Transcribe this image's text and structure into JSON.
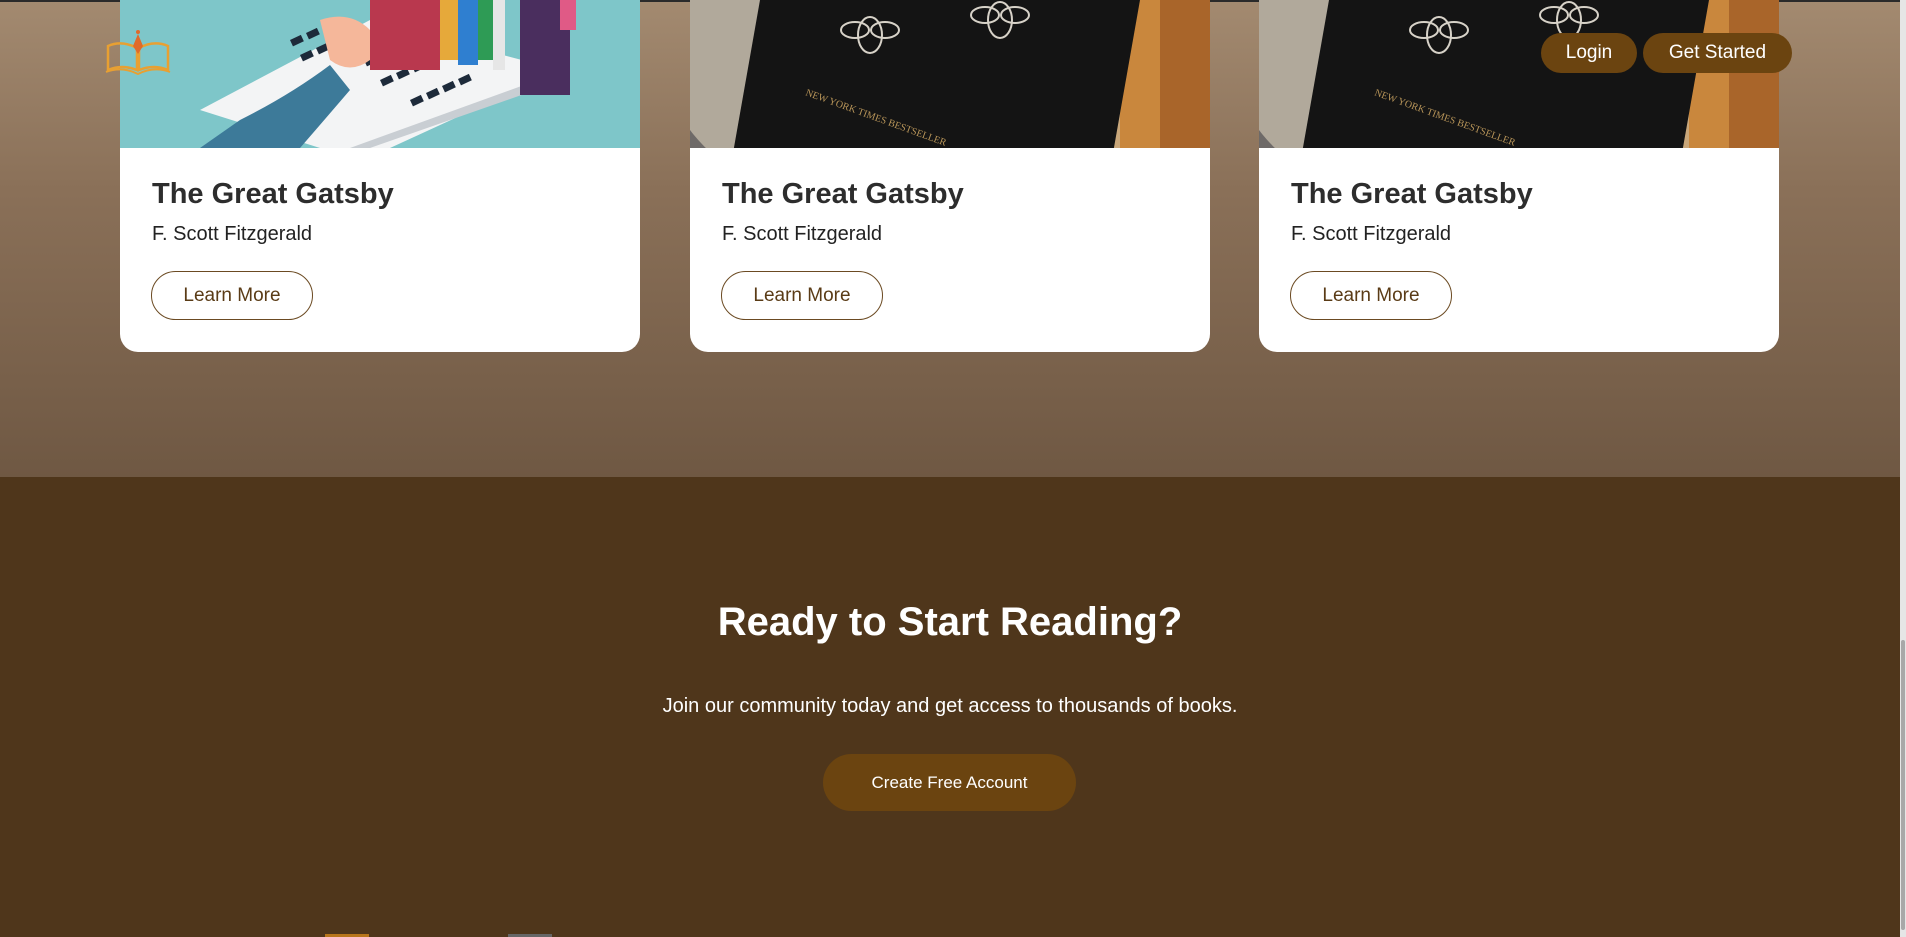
{
  "header": {
    "login_label": "Login",
    "get_started_label": "Get Started"
  },
  "books": [
    {
      "title": "The Great Gatsby",
      "author": "F. Scott Fitzgerald",
      "button": "Learn More",
      "cover": "laptop-books-illustration"
    },
    {
      "title": "The Great Gatsby",
      "author": "F. Scott Fitzgerald",
      "button": "Learn More",
      "cover": "black-book-bee-pattern"
    },
    {
      "title": "The Great Gatsby",
      "author": "F. Scott Fitzgerald",
      "button": "Learn More",
      "cover": "black-book-bee-pattern"
    }
  ],
  "cta": {
    "title": "Ready to Start Reading?",
    "subtitle": "Join our community today and get access to thousands of books.",
    "button": "Create Free Account"
  },
  "colors": {
    "brand_brown": "#6b4410",
    "cta_background": "#4f361b",
    "card_border": "#6b4a22"
  }
}
